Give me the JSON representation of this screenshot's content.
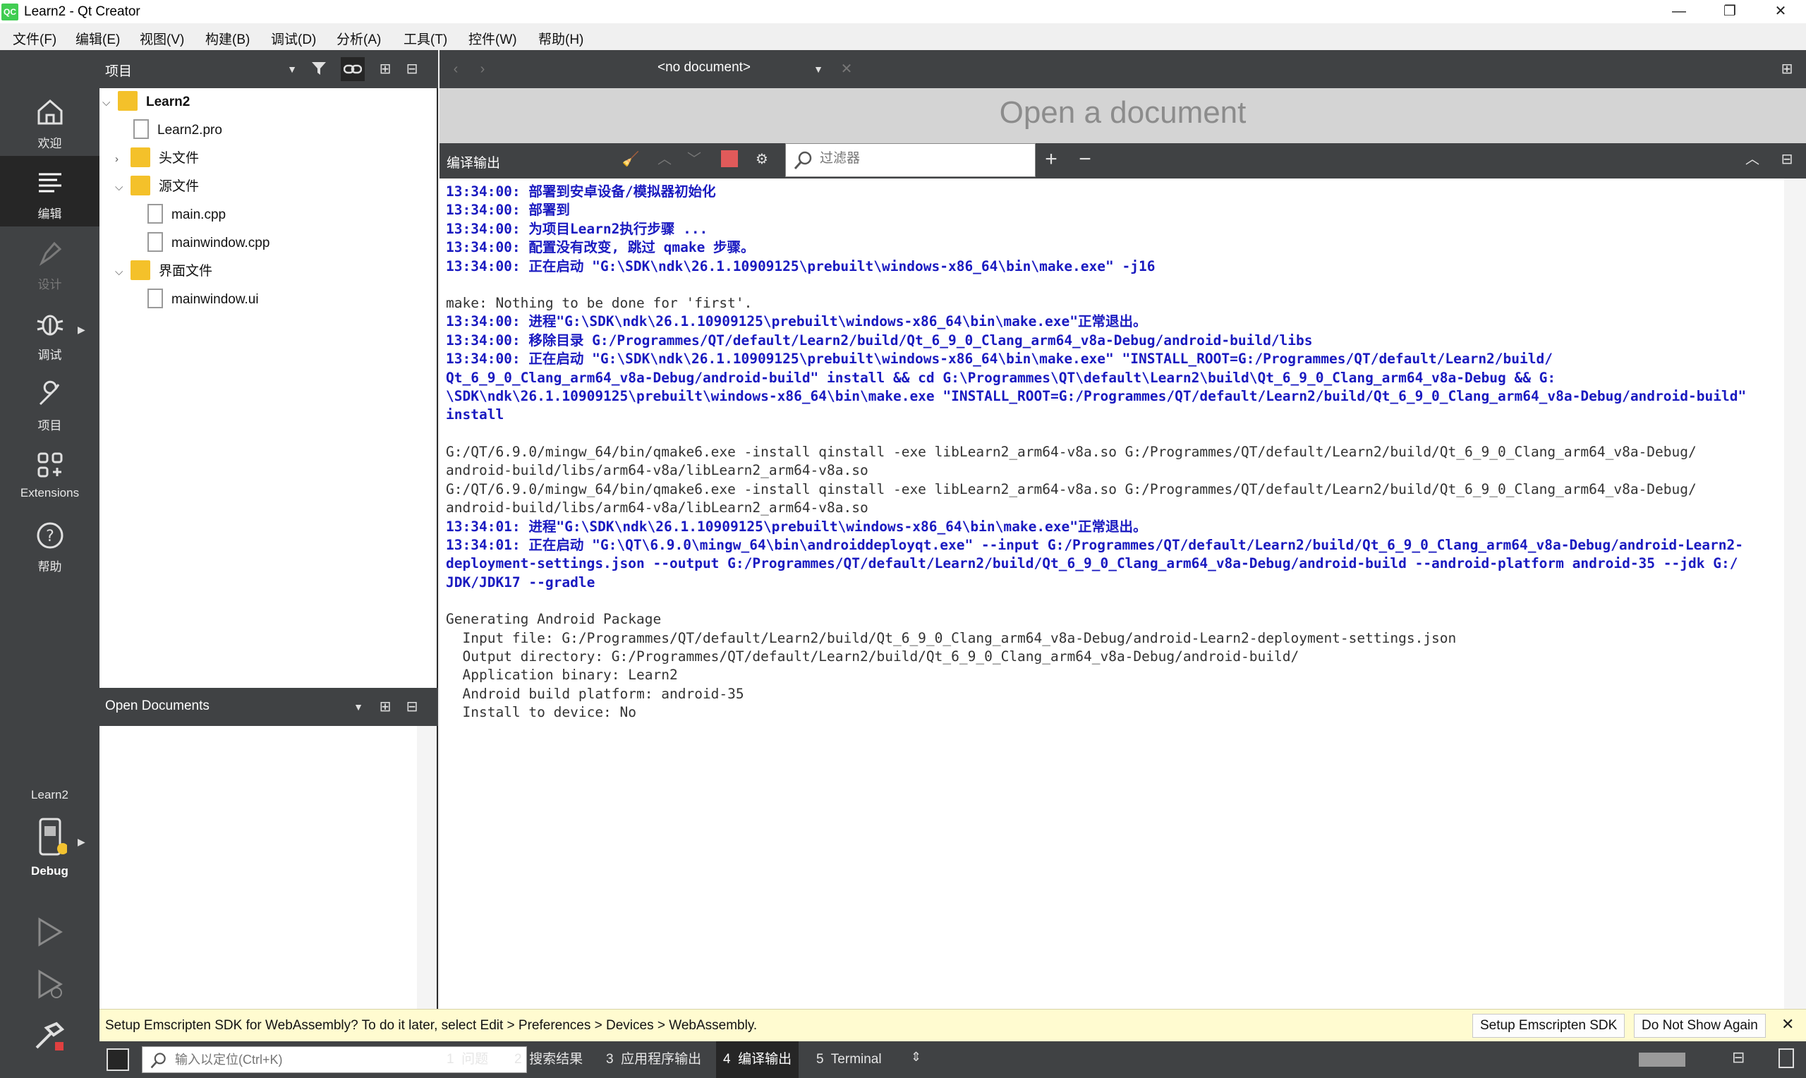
{
  "window": {
    "title": "Learn2 - Qt Creator",
    "logo": "QC",
    "minimize": "—",
    "restore": "❐",
    "close": "✕"
  },
  "menu": [
    "文件(F)",
    "编辑(E)",
    "视图(V)",
    "构建(B)",
    "调试(D)",
    "分析(A)",
    "工具(T)",
    "控件(W)",
    "帮助(H)"
  ],
  "modes": {
    "welcome": "欢迎",
    "edit": "编辑",
    "design": "设计",
    "debug": "调试",
    "projects": "项目",
    "extensions": "Extensions",
    "help": "帮助",
    "target_project": "Learn2",
    "target_config": "Debug"
  },
  "project_pane": {
    "title": "项目",
    "tree": {
      "root": "Learn2",
      "pro_file": "Learn2.pro",
      "headers": "头文件",
      "sources": "源文件",
      "src_files": [
        "main.cpp",
        "mainwindow.cpp"
      ],
      "forms": "界面文件",
      "form_files": [
        "mainwindow.ui"
      ]
    }
  },
  "open_documents": {
    "title": "Open Documents"
  },
  "editor": {
    "document": "<no document>",
    "placeholder": "Open a document"
  },
  "output": {
    "title": "编译输出",
    "filter_placeholder": "过滤器",
    "lines": [
      {
        "t": "13:34:00: 部署到安卓设备/模拟器初始化",
        "b": true
      },
      {
        "t": "13:34:00: 部署到",
        "b": true
      },
      {
        "t": "13:34:00: 为项目Learn2执行步骤 ...",
        "b": true
      },
      {
        "t": "13:34:00: 配置没有改变, 跳过 qmake 步骤。",
        "b": true
      },
      {
        "t": "13:34:00: 正在启动 \"G:\\SDK\\ndk\\26.1.10909125\\prebuilt\\windows-x86_64\\bin\\make.exe\" -j16",
        "b": true
      },
      {
        "t": "",
        "b": false
      },
      {
        "t": "make: Nothing to be done for 'first'.",
        "b": false
      },
      {
        "t": "13:34:00: 进程\"G:\\SDK\\ndk\\26.1.10909125\\prebuilt\\windows-x86_64\\bin\\make.exe\"正常退出。",
        "b": true
      },
      {
        "t": "13:34:00: 移除目录 G:/Programmes/QT/default/Learn2/build/Qt_6_9_0_Clang_arm64_v8a-Debug/android-build/libs",
        "b": true
      },
      {
        "t": "13:34:00: 正在启动 \"G:\\SDK\\ndk\\26.1.10909125\\prebuilt\\windows-x86_64\\bin\\make.exe\" \"INSTALL_ROOT=G:/Programmes/QT/default/Learn2/build/",
        "b": true
      },
      {
        "t": "Qt_6_9_0_Clang_arm64_v8a-Debug/android-build\" install && cd G:\\Programmes\\QT\\default\\Learn2\\build\\Qt_6_9_0_Clang_arm64_v8a-Debug && G:",
        "b": true
      },
      {
        "t": "\\SDK\\ndk\\26.1.10909125\\prebuilt\\windows-x86_64\\bin\\make.exe \"INSTALL_ROOT=G:/Programmes/QT/default/Learn2/build/Qt_6_9_0_Clang_arm64_v8a-Debug/android-build\"",
        "b": true
      },
      {
        "t": "install",
        "b": true
      },
      {
        "t": "",
        "b": false
      },
      {
        "t": "G:/QT/6.9.0/mingw_64/bin/qmake6.exe -install qinstall -exe libLearn2_arm64-v8a.so G:/Programmes/QT/default/Learn2/build/Qt_6_9_0_Clang_arm64_v8a-Debug/",
        "b": false
      },
      {
        "t": "android-build/libs/arm64-v8a/libLearn2_arm64-v8a.so",
        "b": false
      },
      {
        "t": "G:/QT/6.9.0/mingw_64/bin/qmake6.exe -install qinstall -exe libLearn2_arm64-v8a.so G:/Programmes/QT/default/Learn2/build/Qt_6_9_0_Clang_arm64_v8a-Debug/",
        "b": false
      },
      {
        "t": "android-build/libs/arm64-v8a/libLearn2_arm64-v8a.so",
        "b": false
      },
      {
        "t": "13:34:01: 进程\"G:\\SDK\\ndk\\26.1.10909125\\prebuilt\\windows-x86_64\\bin\\make.exe\"正常退出。",
        "b": true
      },
      {
        "t": "13:34:01: 正在启动 \"G:\\QT\\6.9.0\\mingw_64\\bin\\androiddeployqt.exe\" --input G:/Programmes/QT/default/Learn2/build/Qt_6_9_0_Clang_arm64_v8a-Debug/android-Learn2-",
        "b": true
      },
      {
        "t": "deployment-settings.json --output G:/Programmes/QT/default/Learn2/build/Qt_6_9_0_Clang_arm64_v8a-Debug/android-build --android-platform android-35 --jdk G:/",
        "b": true
      },
      {
        "t": "JDK/JDK17 --gradle",
        "b": true
      },
      {
        "t": "",
        "b": false
      },
      {
        "t": "Generating Android Package",
        "b": false
      },
      {
        "t": "  Input file: G:/Programmes/QT/default/Learn2/build/Qt_6_9_0_Clang_arm64_v8a-Debug/android-Learn2-deployment-settings.json",
        "b": false
      },
      {
        "t": "  Output directory: G:/Programmes/QT/default/Learn2/build/Qt_6_9_0_Clang_arm64_v8a-Debug/android-build/",
        "b": false
      },
      {
        "t": "  Application binary: Learn2",
        "b": false
      },
      {
        "t": "  Android build platform: android-35",
        "b": false
      },
      {
        "t": "  Install to device: No",
        "b": false
      }
    ]
  },
  "notification": {
    "text": "Setup Emscripten SDK for WebAssembly? To do it later, select Edit > Preferences > Devices > WebAssembly.",
    "setup_button": "Setup Emscripten SDK",
    "dismiss_button": "Do Not Show Again"
  },
  "statusbar": {
    "locator_placeholder": "输入以定位(Ctrl+K)",
    "tabs": [
      {
        "num": "1",
        "label": "问题"
      },
      {
        "num": "2",
        "label": "搜索结果"
      },
      {
        "num": "3",
        "label": "应用程序输出"
      },
      {
        "num": "4",
        "label": "编译输出"
      },
      {
        "num": "5",
        "label": "Terminal"
      }
    ]
  },
  "colors": {
    "dark": "#404244",
    "active": "#262626",
    "output_blue": "#1a1ac0",
    "notify": "#fffbd0"
  }
}
